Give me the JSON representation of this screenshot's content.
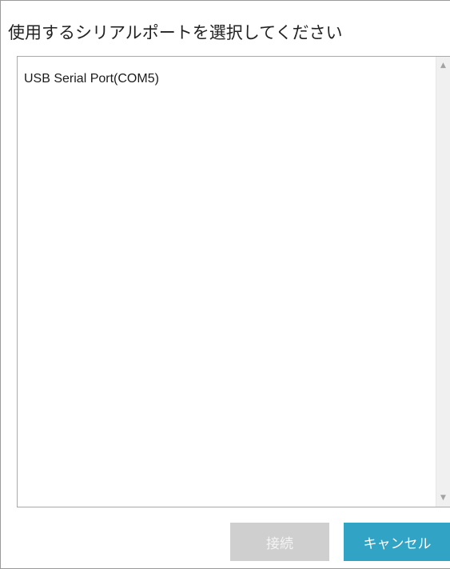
{
  "dialog": {
    "title": "使用するシリアルポートを選択してください"
  },
  "port_list": {
    "items": [
      {
        "label": "USB Serial Port(COM5)"
      }
    ],
    "scroll_up_glyph": "▲",
    "scroll_down_glyph": "▼"
  },
  "buttons": {
    "connect_label": "接続",
    "cancel_label": "キャンセル"
  },
  "colors": {
    "connect_button_disabled": "#cfcfcf",
    "cancel_button": "#31a3c4"
  }
}
